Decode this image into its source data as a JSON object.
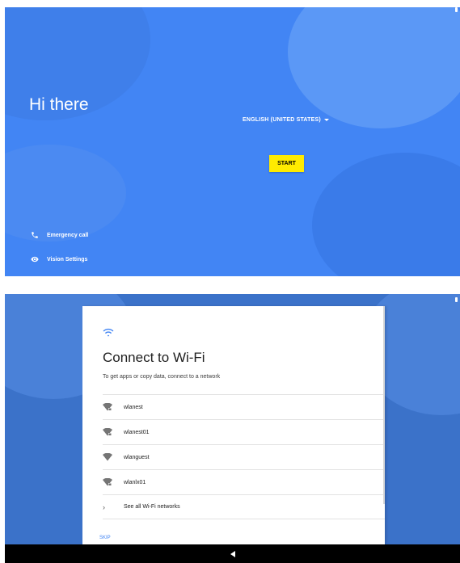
{
  "welcome": {
    "greeting": "Hi there",
    "language": "ENGLISH (UNITED STATES)",
    "start_label": "START",
    "emergency_label": "Emergency call",
    "vision_label": "Vision Settings",
    "colors": {
      "background": "#4285f4",
      "start_button": "#ffeb00"
    }
  },
  "wifi": {
    "title": "Connect to Wi-Fi",
    "subtitle": "To get apps or copy data, connect to a network",
    "networks": [
      {
        "name": "wlanest",
        "icon": "wifi-locked-icon"
      },
      {
        "name": "wlanest01",
        "icon": "wifi-locked-icon"
      },
      {
        "name": "wlanguest",
        "icon": "wifi-icon"
      },
      {
        "name": "wlanlx01",
        "icon": "wifi-locked-icon"
      }
    ],
    "see_all_label": "See all Wi-Fi networks",
    "skip_label": "SKIP"
  },
  "navbar": {
    "back_icon": "back-triangle-icon"
  }
}
